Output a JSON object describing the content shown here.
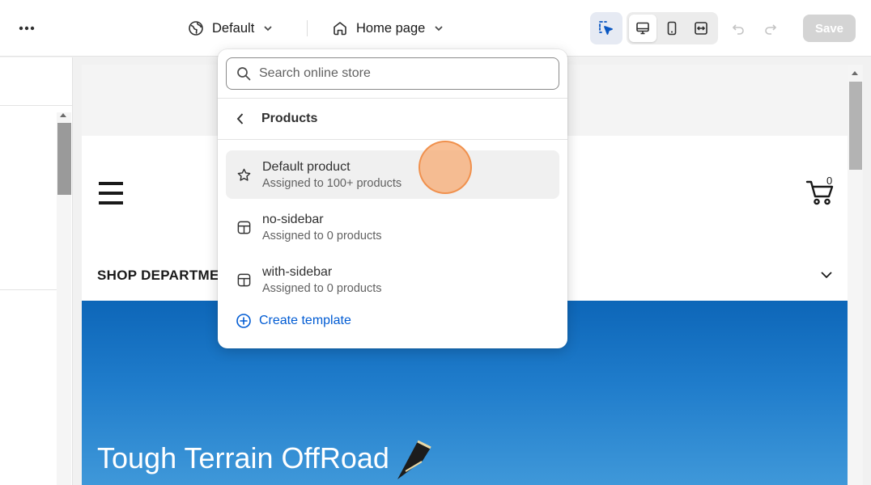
{
  "topbar": {
    "theme_name": "Default",
    "page_name": "Home page",
    "save_label": "Save"
  },
  "popover": {
    "search_placeholder": "Search online store",
    "back_title": "Products",
    "templates": [
      {
        "name": "Default product",
        "subtitle": "Assigned to 100+ products",
        "icon": "star-icon",
        "selected": true
      },
      {
        "name": "no-sidebar",
        "subtitle": "Assigned to 0 products",
        "icon": "layout-icon",
        "selected": false
      },
      {
        "name": "with-sidebar",
        "subtitle": "Assigned to 0 products",
        "icon": "layout-icon",
        "selected": false
      }
    ],
    "create_label": "Create template"
  },
  "preview": {
    "cart_count": "0",
    "shop_departments": "SHOP DEPARTME",
    "hero_title": "Tough Terrain OffRoad"
  },
  "colors": {
    "accent_blue": "#005bd3",
    "inspect_icon": "#0a57c2",
    "save_disabled": "#d4d4d4",
    "hero_blue": "#1f7ccb",
    "click_indicator": "#f6a76e"
  }
}
